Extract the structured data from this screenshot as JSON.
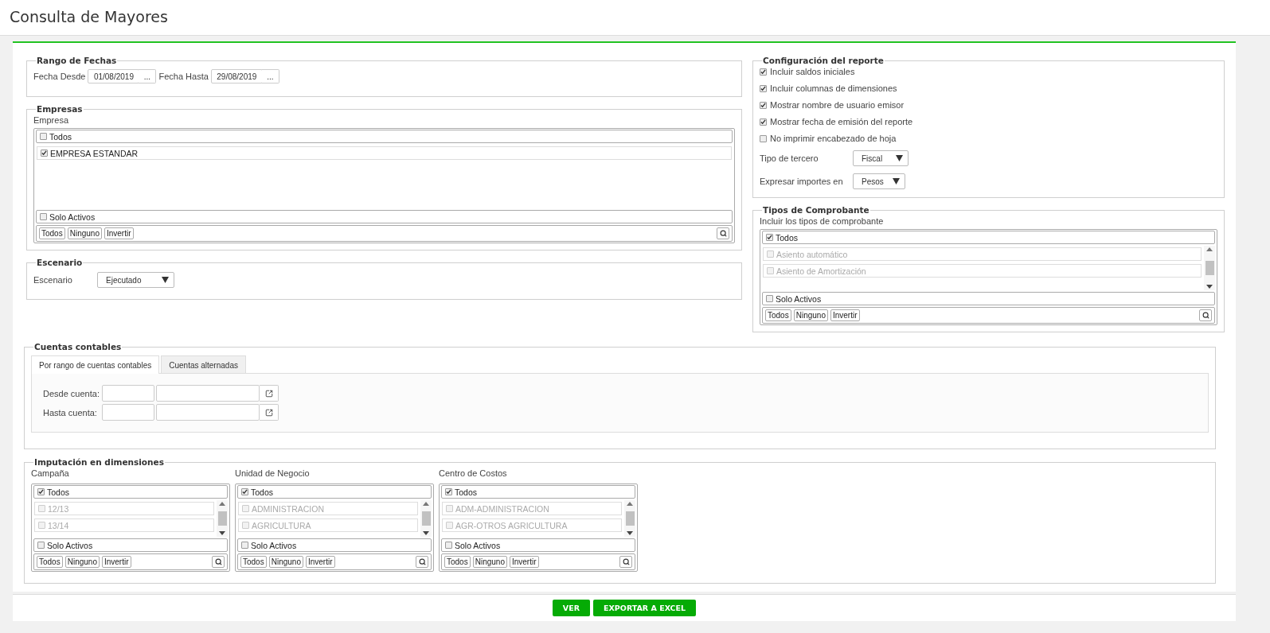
{
  "page_title": "Consulta de Mayores",
  "rango_fechas": {
    "legend": "Rango de Fechas",
    "fields": [
      {
        "label": "Fecha Desde",
        "value": "01/08/2019",
        "button": "..."
      },
      {
        "label": "Fecha Hasta",
        "value": "29/08/2019",
        "button": "..."
      }
    ]
  },
  "empresas": {
    "legend": "Empresas",
    "label": "Empresa",
    "list": {
      "all": {
        "label": "Todos",
        "checked": false
      },
      "scrollable": false,
      "items": [
        {
          "label": "EMPRESA ESTANDAR",
          "checked": true,
          "disabled": false
        }
      ],
      "only_active": {
        "label": "Solo Activos",
        "checked": false
      },
      "actions": [
        "Todos",
        "Ninguno",
        "Invertir"
      ]
    }
  },
  "escenario": {
    "legend": "Escenario",
    "label": "Escenario",
    "value": "Ejecutado"
  },
  "configuracion": {
    "legend": "Configuración del reporte",
    "options": [
      {
        "label": "Incluir saldos iniciales",
        "checked": true
      },
      {
        "label": "Incluir columnas de dimensiones",
        "checked": true
      },
      {
        "label": "Mostrar nombre de usuario emisor",
        "checked": true
      },
      {
        "label": "Mostrar fecha de emisión del reporte",
        "checked": true
      },
      {
        "label": "No imprimir encabezado de hoja",
        "checked": false
      }
    ],
    "selects": [
      {
        "label": "Tipo de tercero",
        "value": "Fiscal"
      },
      {
        "label": "Expresar importes en",
        "value": "Pesos"
      }
    ]
  },
  "tipos_comprobante": {
    "legend": "Tipos de Comprobante",
    "label": "Incluir los tipos de comprobante",
    "list": {
      "all": {
        "label": "Todos",
        "checked": true
      },
      "scrollable": true,
      "items": [
        {
          "label": "Asiento automático",
          "checked": false,
          "disabled": true
        },
        {
          "label": "Asiento de Amortización",
          "checked": false,
          "disabled": true
        }
      ],
      "only_active": {
        "label": "Solo Activos",
        "checked": false
      },
      "actions": [
        "Todos",
        "Ninguno",
        "Invertir"
      ]
    }
  },
  "cuentas_contables": {
    "legend": "Cuentas contables",
    "tabs": [
      {
        "label": "Por rango de cuentas contables",
        "selected": true
      },
      {
        "label": "Cuentas alternadas",
        "selected": false
      }
    ],
    "rows": [
      {
        "label": "Desde cuenta:"
      },
      {
        "label": "Hasta cuenta:"
      }
    ]
  },
  "imputacion": {
    "legend": "Imputación en dimensiones",
    "columns": [
      {
        "label": "Campaña",
        "list": {
          "all": {
            "label": "Todos",
            "checked": true
          },
          "scrollable": true,
          "items": [
            {
              "label": "12/13",
              "checked": false,
              "disabled": true
            },
            {
              "label": "13/14",
              "checked": false,
              "disabled": true
            }
          ],
          "only_active": {
            "label": "Solo Activos",
            "checked": false
          },
          "actions": [
            "Todos",
            "Ninguno",
            "Invertir"
          ]
        }
      },
      {
        "label": "Unidad de Negocio",
        "list": {
          "all": {
            "label": "Todos",
            "checked": true
          },
          "scrollable": true,
          "items": [
            {
              "label": "ADMINISTRACION",
              "checked": false,
              "disabled": true
            },
            {
              "label": "AGRICULTURA",
              "checked": false,
              "disabled": true
            }
          ],
          "only_active": {
            "label": "Solo Activos",
            "checked": false
          },
          "actions": [
            "Todos",
            "Ninguno",
            "Invertir"
          ]
        }
      },
      {
        "label": "Centro de Costos",
        "list": {
          "all": {
            "label": "Todos",
            "checked": true
          },
          "scrollable": true,
          "items": [
            {
              "label": "ADM-ADMINISTRACION",
              "checked": false,
              "disabled": true
            },
            {
              "label": "AGR-OTROS AGRICULTURA",
              "checked": false,
              "disabled": true
            }
          ],
          "only_active": {
            "label": "Solo Activos",
            "checked": false
          },
          "actions": [
            "Todos",
            "Ninguno",
            "Invertir"
          ]
        }
      }
    ]
  },
  "buttons": [
    "VER",
    "EXPORTAR A EXCEL"
  ]
}
